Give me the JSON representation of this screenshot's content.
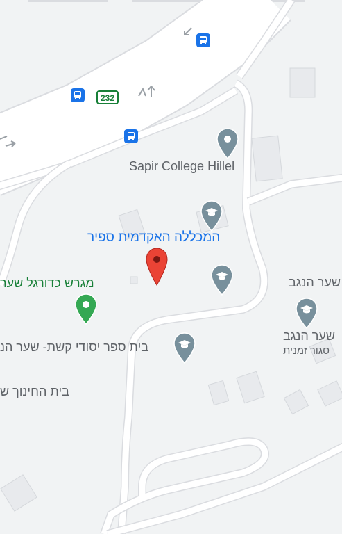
{
  "colors": {
    "land": "#f1f3f4",
    "road_fill": "#ffffff",
    "road_edge": "#dadce0",
    "building": "#e8eaed",
    "poi_gray": "#78909c",
    "poi_green": "#34a853",
    "pin_red": "#ea4335",
    "label_gray": "#5f6368",
    "label_blue": "#1a73e8",
    "label_green": "#188038",
    "route_shield": "#188038",
    "bus_blue": "#1a73e8"
  },
  "road": {
    "route_number": "232"
  },
  "labels": {
    "sapir_hillel": "Sapir College Hillel",
    "sapir_academic": "המכללה האקדמית ספיר",
    "football_field": "מגרש כדורגל שער",
    "shaar_hanegev_top": "שער הנגב",
    "shaar_hanegev_name": "שער הנגב",
    "shaar_hanegev_status": "סגור זמנית",
    "keshet_school": "בית ספר יסודי קשת- שער הנ",
    "education_house": "בית החינוך ש"
  },
  "icons": {
    "bus_stop": "bus-stop-icon",
    "school": "school-icon",
    "place": "place-pin-icon",
    "park": "park-pin-icon",
    "dropped_pin": "dropped-pin-icon",
    "arrow": "direction-arrow-icon"
  }
}
